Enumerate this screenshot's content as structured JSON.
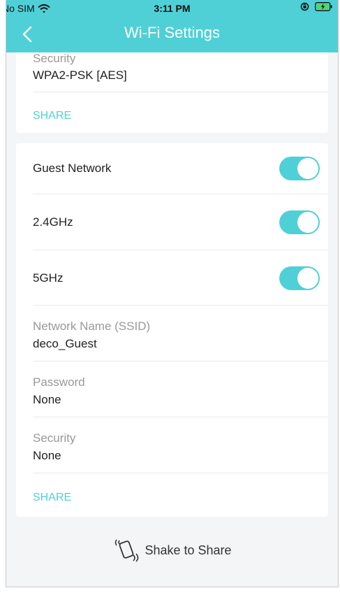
{
  "status_bar": {
    "carrier": "No SIM",
    "time": "3:11 PM"
  },
  "nav": {
    "title": "Wi-Fi Settings"
  },
  "main_network": {
    "security_label": "Security",
    "security_value": "WPA2-PSK [AES]",
    "share_label": "SHARE"
  },
  "guest": {
    "guest_network_label": "Guest Network",
    "guest_network_on": true,
    "band_24_label": "2.4GHz",
    "band_24_on": true,
    "band_5_label": "5GHz",
    "band_5_on": true,
    "ssid_label": "Network Name (SSID)",
    "ssid_value": "deco_Guest",
    "password_label": "Password",
    "password_value": "None",
    "security_label": "Security",
    "security_value": "None",
    "share_label": "SHARE"
  },
  "footer": {
    "shake_label": "Shake to Share"
  },
  "colors": {
    "accent": "#4fd0d6"
  }
}
